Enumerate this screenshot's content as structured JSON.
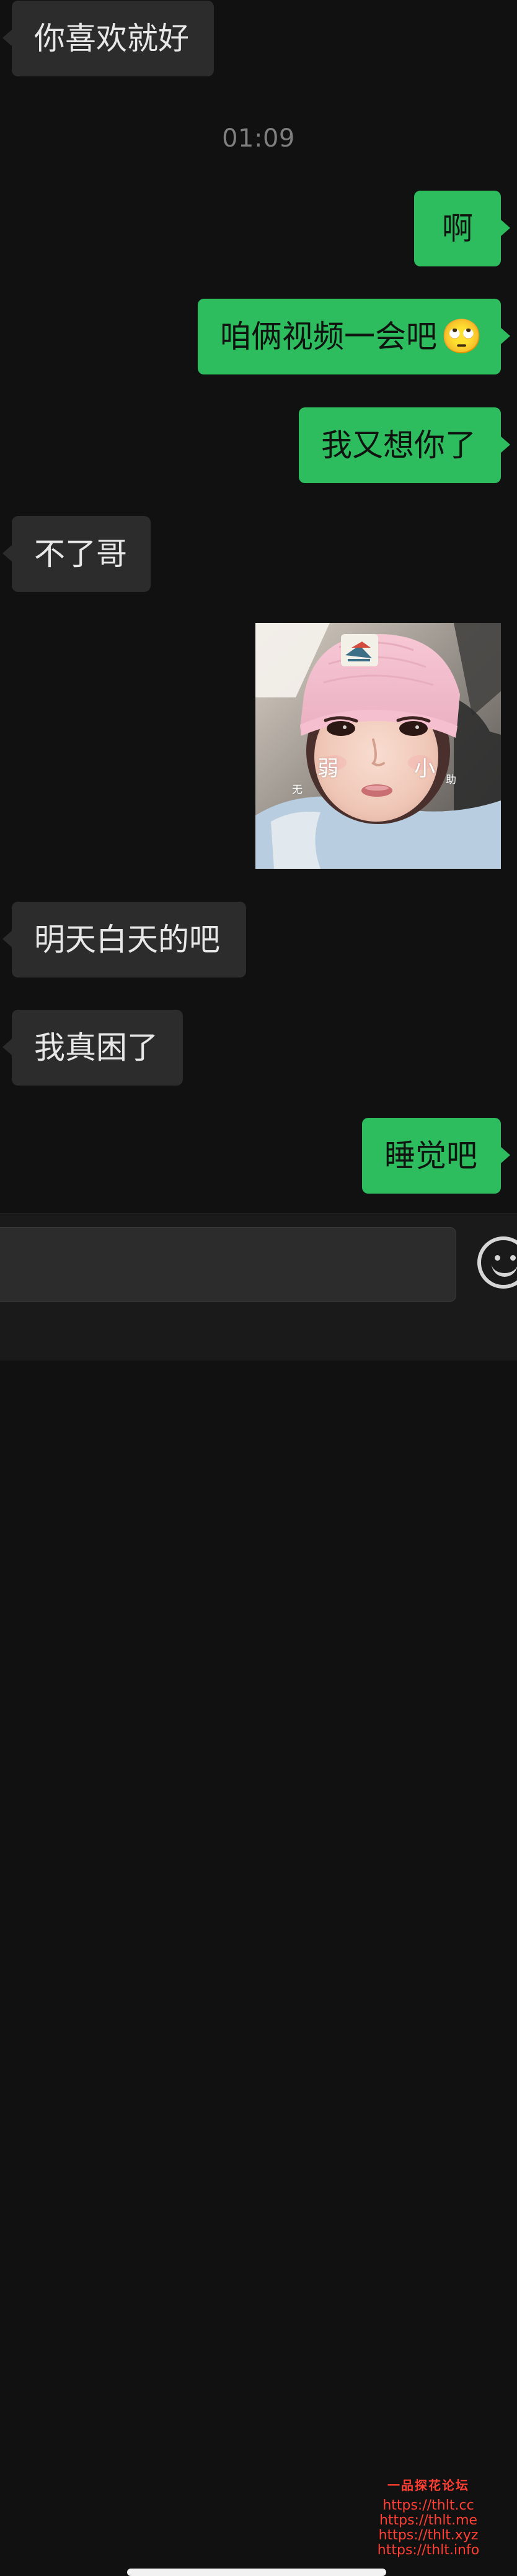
{
  "timestamp": "01:09",
  "messages": [
    {
      "text": "你喜欢就好"
    },
    {
      "text": "啊"
    },
    {
      "text": "咱俩视频一会吧",
      "emoji": "🙄"
    },
    {
      "text": "我又想你了"
    },
    {
      "text": "不了哥"
    },
    {
      "text": "明天白天的吧"
    },
    {
      "text": "我真困了"
    },
    {
      "text": "睡觉吧"
    }
  ],
  "media": {
    "labels": [
      "弱",
      "小",
      "无",
      "助"
    ]
  },
  "input": {
    "value": "",
    "placeholder": ""
  },
  "emoji_button": {
    "icon": "smiley-icon"
  },
  "watermark": {
    "title": "一品探花论坛",
    "lines": [
      "https://thlt.cc",
      "https://thlt.me",
      "https://thlt.xyz",
      "https://thlt.info"
    ]
  },
  "colors": {
    "background": "#111111",
    "incoming_bubble": "#2c2c2c",
    "outgoing_bubble": "#2dbd5f",
    "timestamp": "#7f7f7f",
    "watermark": "#ff3f33"
  }
}
